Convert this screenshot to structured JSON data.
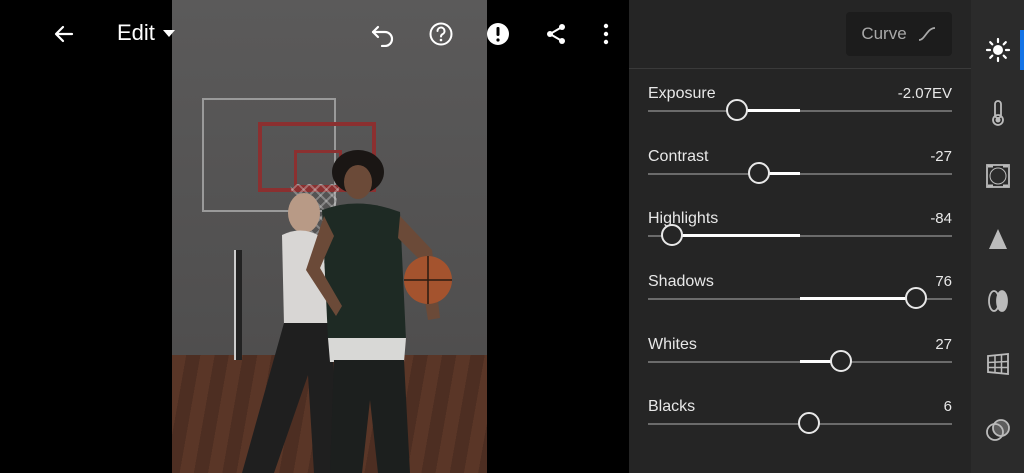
{
  "toolbar": {
    "edit_label": "Edit",
    "icons": [
      "back-arrow-icon",
      "undo-icon",
      "help-icon",
      "alert-icon",
      "share-icon",
      "more-vertical-icon"
    ]
  },
  "curve_button": {
    "label": "Curve",
    "icon": "curve-icon"
  },
  "light_panel": {
    "sliders": [
      {
        "label": "Exposure",
        "value": "-2.07EV",
        "level": -0.414
      },
      {
        "label": "Contrast",
        "value": "-27",
        "level": -0.27
      },
      {
        "label": "Highlights",
        "value": "-84",
        "level": -0.84
      },
      {
        "label": "Shadows",
        "value": "76",
        "level": 0.76
      },
      {
        "label": "Whites",
        "value": "27",
        "level": 0.27
      },
      {
        "label": "Blacks",
        "value": "6",
        "level": 0.06
      }
    ]
  },
  "rail": {
    "active_color": "#1473e6",
    "items": [
      "light-icon",
      "color-temperature-icon",
      "effects-vignette-icon",
      "detail-icon",
      "optics-icon",
      "geometry-icon",
      "mixer-icon"
    ]
  }
}
